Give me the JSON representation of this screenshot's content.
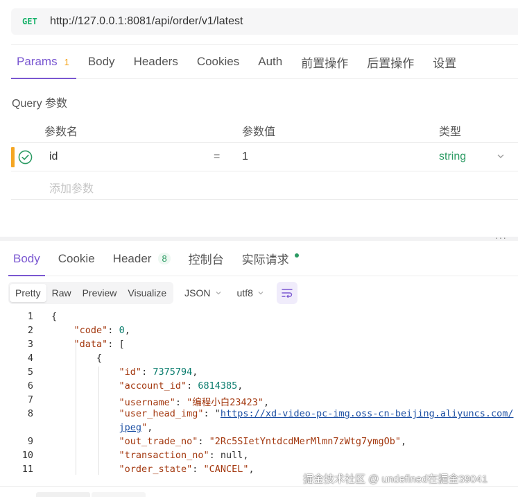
{
  "request": {
    "method": "GET",
    "url": "http://127.0.0.1:8081/api/order/v1/latest"
  },
  "request_tabs": [
    {
      "label": "Params",
      "badge": "1"
    },
    {
      "label": "Body"
    },
    {
      "label": "Headers"
    },
    {
      "label": "Cookies"
    },
    {
      "label": "Auth"
    },
    {
      "label": "前置操作"
    },
    {
      "label": "后置操作"
    },
    {
      "label": "设置"
    }
  ],
  "query": {
    "title": "Query 参数",
    "columns": {
      "name": "参数名",
      "value": "参数值",
      "type": "类型"
    },
    "params": [
      {
        "name": "id",
        "operator": "=",
        "value": "1",
        "type": "string"
      }
    ],
    "add_placeholder": "添加参数"
  },
  "response_tabs": [
    {
      "label": "Body"
    },
    {
      "label": "Cookie"
    },
    {
      "label": "Header",
      "badge": "8"
    },
    {
      "label": "控制台"
    },
    {
      "label": "实际请求"
    }
  ],
  "format": {
    "views": [
      "Pretty",
      "Raw",
      "Preview",
      "Visualize"
    ],
    "language": "JSON",
    "encoding": "utf8"
  },
  "code_lines": [
    {
      "n": "1",
      "t": "{"
    },
    {
      "n": "2",
      "t": "    \"code\": 0,"
    },
    {
      "n": "3",
      "t": "    \"data\": ["
    },
    {
      "n": "4",
      "t": "        {"
    },
    {
      "n": "5",
      "t": "            \"id\": 7375794,"
    },
    {
      "n": "6",
      "t": "            \"account_id\": 6814385,"
    },
    {
      "n": "7",
      "t": "            \"username\": \"编程小白23423\","
    },
    {
      "n": "8",
      "t": "            \"user_head_img\": \"https://xd-video-pc-img.oss-cn-beijing.aliyuncs.com/"
    },
    {
      "n": "",
      "t": "            jpeg\","
    },
    {
      "n": "9",
      "t": "            \"out_trade_no\": \"2Rc5SIetYntdcdMerMlmn7zWtg7ymgOb\","
    },
    {
      "n": "10",
      "t": "            \"transaction_no\": null,"
    },
    {
      "n": "11",
      "t": "            \"order_state\": \"CANCEL\","
    }
  ],
  "watermark": "掘金技术社区 @ undefined在掘金39041",
  "colors": {
    "accent": "#7a57d1",
    "get": "#17b26a",
    "badge_orange": "#f59e0b",
    "type_green": "#2a9a62"
  }
}
